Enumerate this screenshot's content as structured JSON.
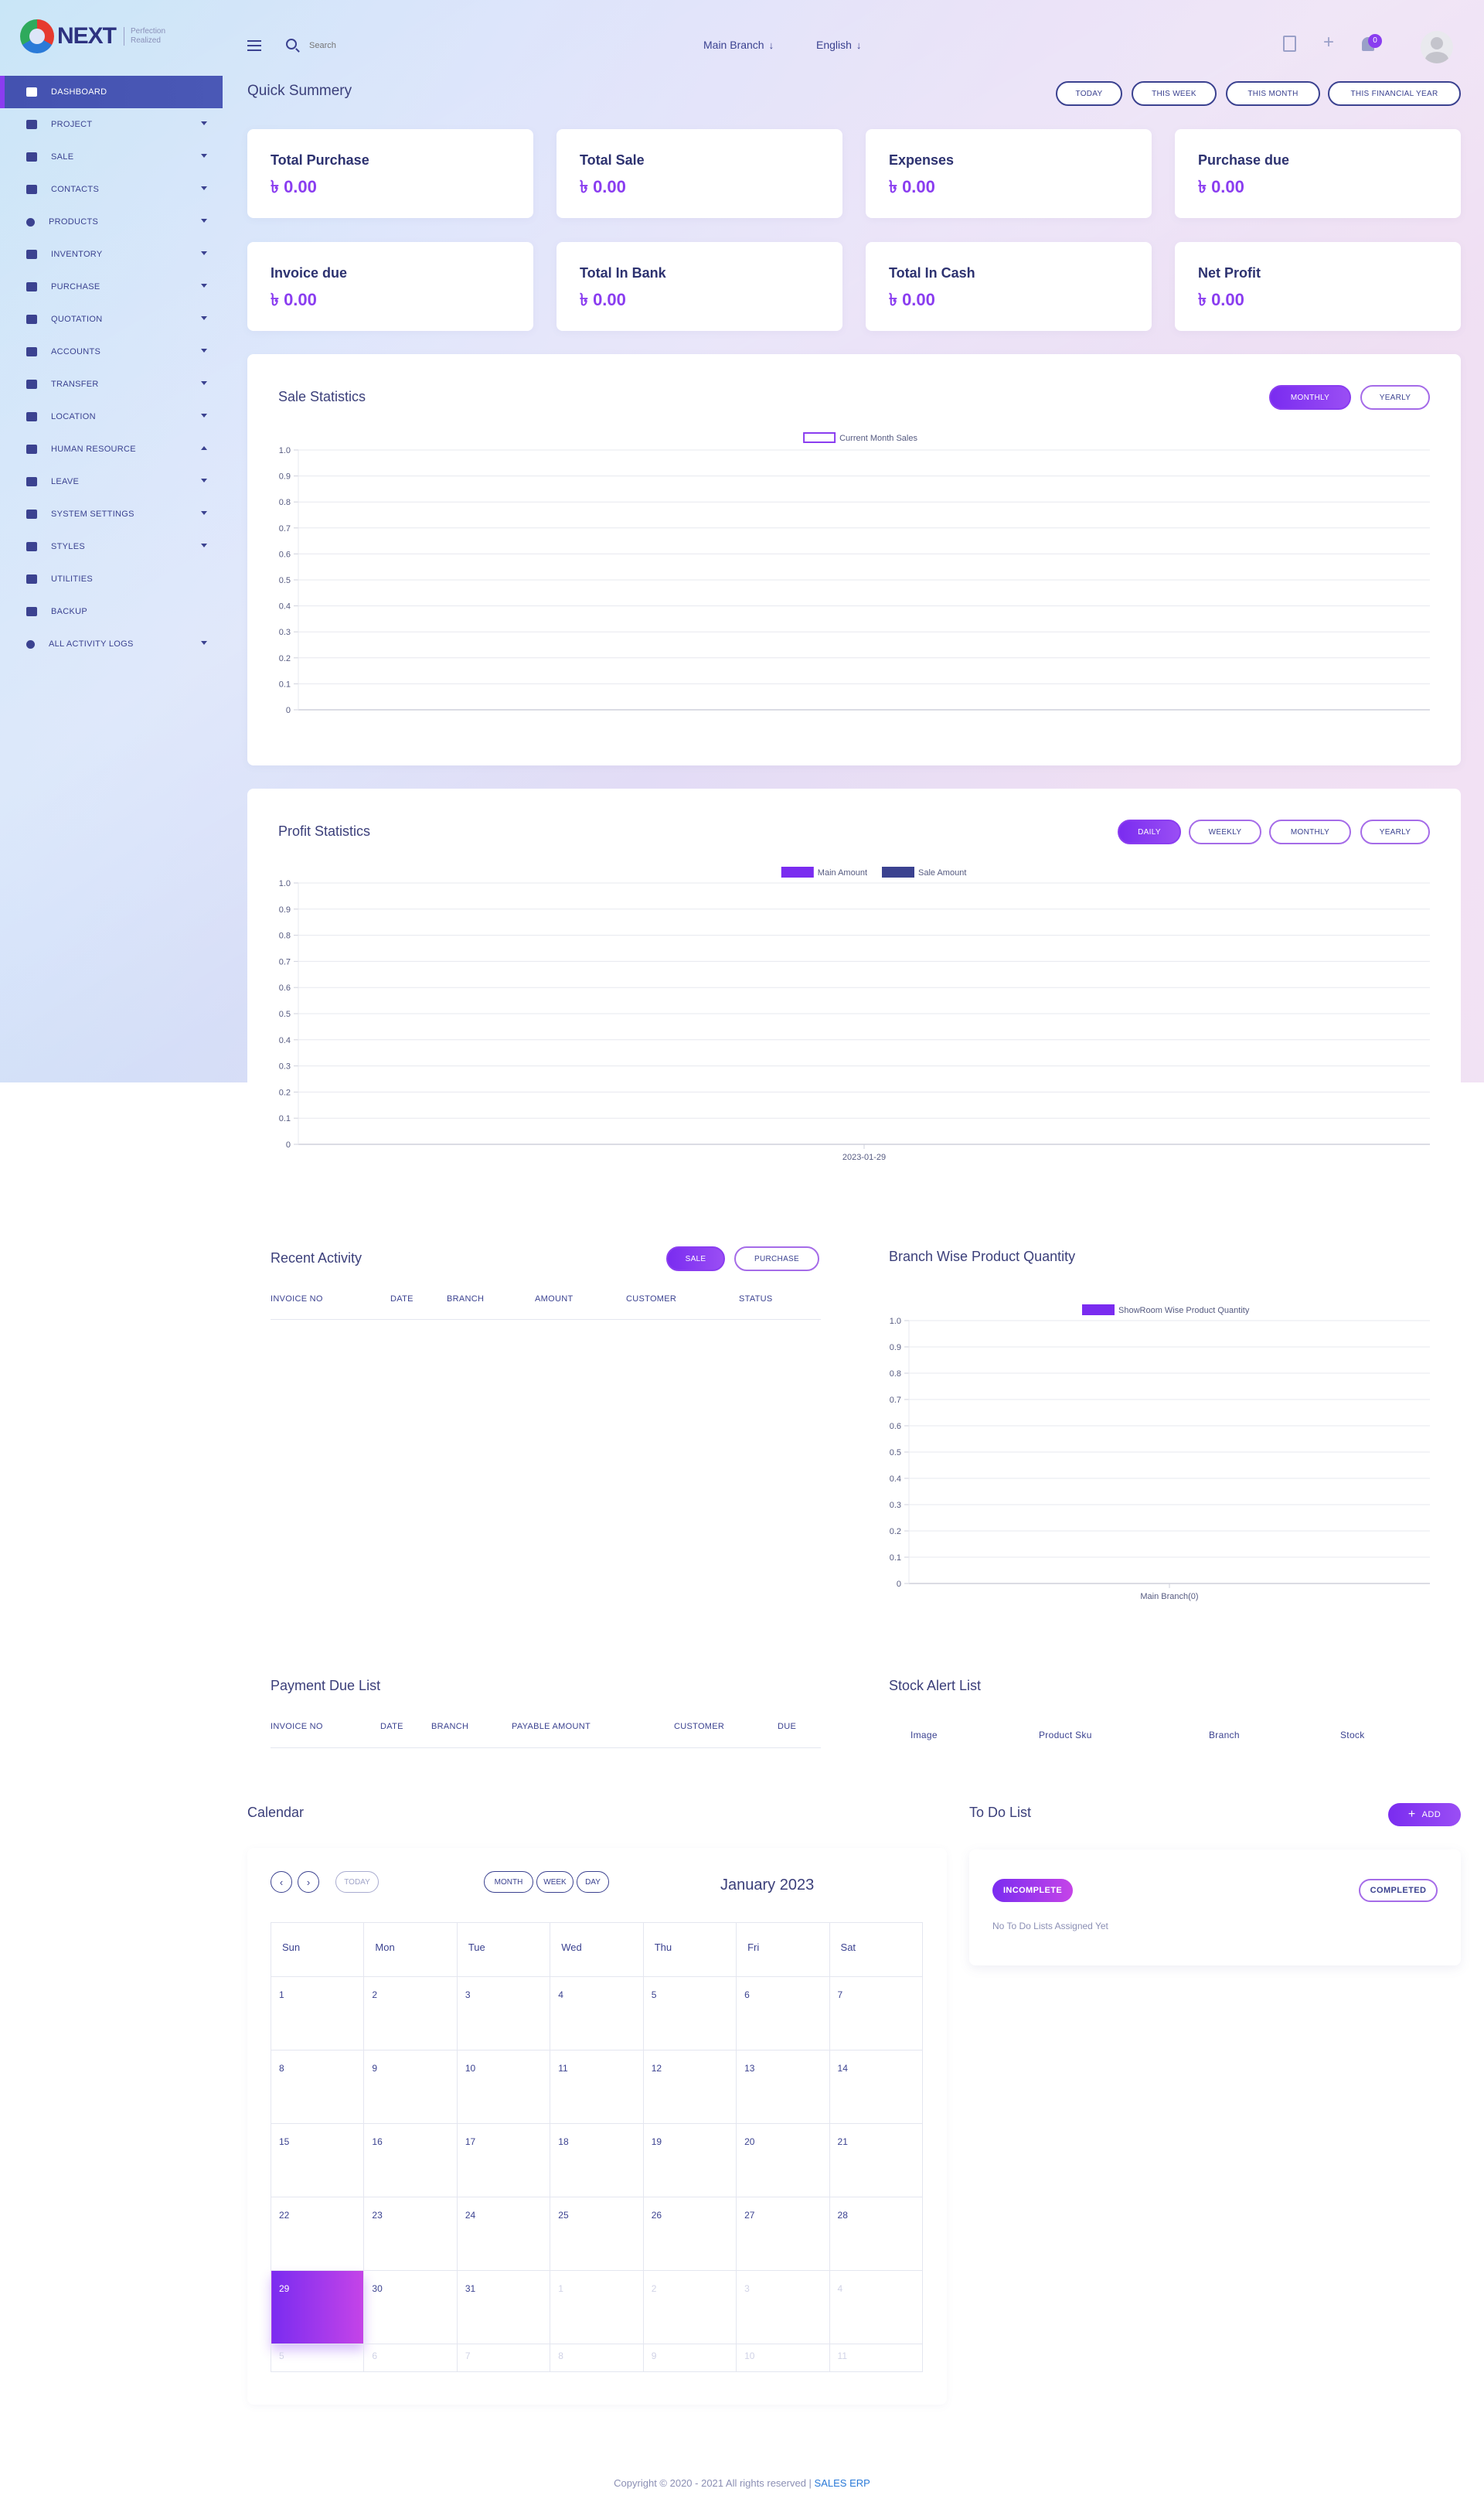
{
  "brand": {
    "name": "NEXT",
    "tagline": "Perfection Realized"
  },
  "sidebar": {
    "items": [
      {
        "label": "DASHBOARD",
        "icon": "grid-icon",
        "has_caret": false,
        "active": true
      },
      {
        "label": "PROJECT",
        "icon": "users-icon",
        "has_caret": true
      },
      {
        "label": "SALE",
        "icon": "box-icon",
        "has_caret": true
      },
      {
        "label": "CONTACTS",
        "icon": "contact-icon",
        "has_caret": true
      },
      {
        "label": "PRODUCTS",
        "icon": "product-icon",
        "has_caret": true
      },
      {
        "label": "INVENTORY",
        "icon": "inventory-icon",
        "has_caret": true
      },
      {
        "label": "PURCHASE",
        "icon": "purchase-icon",
        "has_caret": true
      },
      {
        "label": "QUOTATION",
        "icon": "quotation-icon",
        "has_caret": true
      },
      {
        "label": "ACCOUNTS",
        "icon": "chart-icon",
        "has_caret": true
      },
      {
        "label": "TRANSFER",
        "icon": "transfer-icon",
        "has_caret": true
      },
      {
        "label": "LOCATION",
        "icon": "location-icon",
        "has_caret": true
      },
      {
        "label": "HUMAN RESOURCE",
        "icon": "hr-icon",
        "has_caret": true,
        "caret_up": true
      },
      {
        "label": "LEAVE",
        "icon": "leave-icon",
        "has_caret": true
      },
      {
        "label": "SYSTEM SETTINGS",
        "icon": "settings-icon",
        "has_caret": true
      },
      {
        "label": "STYLES",
        "icon": "styles-icon",
        "has_caret": true
      },
      {
        "label": "UTILITIES",
        "icon": "utilities-icon",
        "has_caret": false
      },
      {
        "label": "BACKUP",
        "icon": "backup-icon",
        "has_caret": false
      },
      {
        "label": "ALL ACTIVITY LOGS",
        "icon": "logs-icon",
        "has_caret": true
      }
    ]
  },
  "topbar": {
    "search_placeholder": "Search",
    "branch": "Main Branch",
    "language": "English",
    "notification_count": "0"
  },
  "quick_summary": {
    "title": "Quick Summery",
    "filters": [
      "TODAY",
      "THIS WEEK",
      "THIS MONTH",
      "THIS FINANCIAL YEAR"
    ],
    "cards": [
      {
        "label": "Total Purchase",
        "value": "৳ 0.00"
      },
      {
        "label": "Total Sale",
        "value": "৳ 0.00"
      },
      {
        "label": "Expenses",
        "value": "৳ 0.00"
      },
      {
        "label": "Purchase due",
        "value": "৳ 0.00"
      },
      {
        "label": "Invoice due",
        "value": "৳ 0.00"
      },
      {
        "label": "Total In Bank",
        "value": "৳ 0.00"
      },
      {
        "label": "Total In Cash",
        "value": "৳ 0.00"
      },
      {
        "label": "Net Profit",
        "value": "৳ 0.00"
      }
    ]
  },
  "sale_statistics": {
    "title": "Sale Statistics",
    "toggles": [
      "MONTHLY",
      "YEARLY"
    ],
    "active_toggle": "MONTHLY"
  },
  "profit_statistics": {
    "title": "Profit Statistics",
    "toggles": [
      "DAILY",
      "WEEKLY",
      "MONTHLY",
      "YEARLY"
    ],
    "active_toggle": "DAILY"
  },
  "recent_activity": {
    "title": "Recent Activity",
    "toggles": [
      "SALE",
      "PURCHASE"
    ],
    "active_toggle": "SALE",
    "columns": [
      "INVOICE NO",
      "DATE",
      "BRANCH",
      "AMOUNT",
      "CUSTOMER",
      "STATUS"
    ]
  },
  "branch_wise": {
    "title": "Branch Wise Product Quantity"
  },
  "payment_due": {
    "title": "Payment Due List",
    "columns": [
      "INVOICE NO",
      "DATE",
      "BRANCH",
      "PAYABLE AMOUNT",
      "CUSTOMER",
      "DUE"
    ]
  },
  "stock_alert": {
    "title": "Stock Alert List",
    "columns": [
      "Image",
      "Product Sku",
      "Branch",
      "Stock"
    ]
  },
  "calendar": {
    "title": "Calendar",
    "today_label": "TODAY",
    "views": [
      "MONTH",
      "WEEK",
      "DAY"
    ],
    "month_title": "January 2023",
    "weekdays": [
      "Sun",
      "Mon",
      "Tue",
      "Wed",
      "Thu",
      "Fri",
      "Sat"
    ],
    "weeks": [
      [
        "1",
        "2",
        "3",
        "4",
        "5",
        "6",
        "7"
      ],
      [
        "8",
        "9",
        "10",
        "11",
        "12",
        "13",
        "14"
      ],
      [
        "15",
        "16",
        "17",
        "18",
        "19",
        "20",
        "21"
      ],
      [
        "22",
        "23",
        "24",
        "25",
        "26",
        "27",
        "28"
      ],
      [
        "29",
        "30",
        "31",
        "1",
        "2",
        "3",
        "4"
      ],
      [
        "5",
        "6",
        "7",
        "8",
        "9",
        "10",
        "11"
      ]
    ],
    "today": "29"
  },
  "todo": {
    "title": "To Do List",
    "add_label": "ADD",
    "incomplete_label": "INCOMPLETE",
    "completed_label": "COMPLETED",
    "empty_text": "No To Do Lists Assigned Yet"
  },
  "footer": {
    "text": "Copyright © 2020 - 2021 All rights reserved | ",
    "brand": "SALES ERP"
  },
  "chart_data": [
    {
      "type": "line",
      "name": "sale-statistics-chart",
      "series": [
        {
          "name": "Current Month Sales",
          "values": [],
          "color": "#8a3df0"
        }
      ],
      "x": [],
      "ylim": [
        0,
        1.0
      ],
      "yticks": [
        "0",
        "0.1",
        "0.2",
        "0.3",
        "0.4",
        "0.5",
        "0.6",
        "0.7",
        "0.8",
        "0.9",
        "1.0"
      ],
      "legend": "top-center",
      "grid": true
    },
    {
      "type": "bar",
      "name": "profit-statistics-chart",
      "categories": [
        "2023-01-29"
      ],
      "series": [
        {
          "name": "Main Amount",
          "values": [
            0
          ],
          "color": "#7a2cf0"
        },
        {
          "name": "Sale Amount",
          "values": [
            0
          ],
          "color": "#3b4290"
        }
      ],
      "ylim": [
        0,
        1.0
      ],
      "yticks": [
        "0",
        "0.1",
        "0.2",
        "0.3",
        "0.4",
        "0.5",
        "0.6",
        "0.7",
        "0.8",
        "0.9",
        "1.0"
      ],
      "legend": "top-center",
      "grid": true
    },
    {
      "type": "bar",
      "name": "branch-wise-chart",
      "categories": [
        "Main Branch(0)"
      ],
      "series": [
        {
          "name": "ShowRoom Wise Product Quantity",
          "values": [
            0
          ],
          "color": "#7a2cf0"
        }
      ],
      "ylim": [
        0,
        1.0
      ],
      "yticks": [
        "0",
        "0.1",
        "0.2",
        "0.3",
        "0.4",
        "0.5",
        "0.6",
        "0.7",
        "0.8",
        "0.9",
        "1.0"
      ],
      "legend": "top-center",
      "grid": true
    }
  ],
  "colors": {
    "accent": "#8a3df0",
    "primary": "#3b4290",
    "sidebar_active": "#4a58b6"
  }
}
